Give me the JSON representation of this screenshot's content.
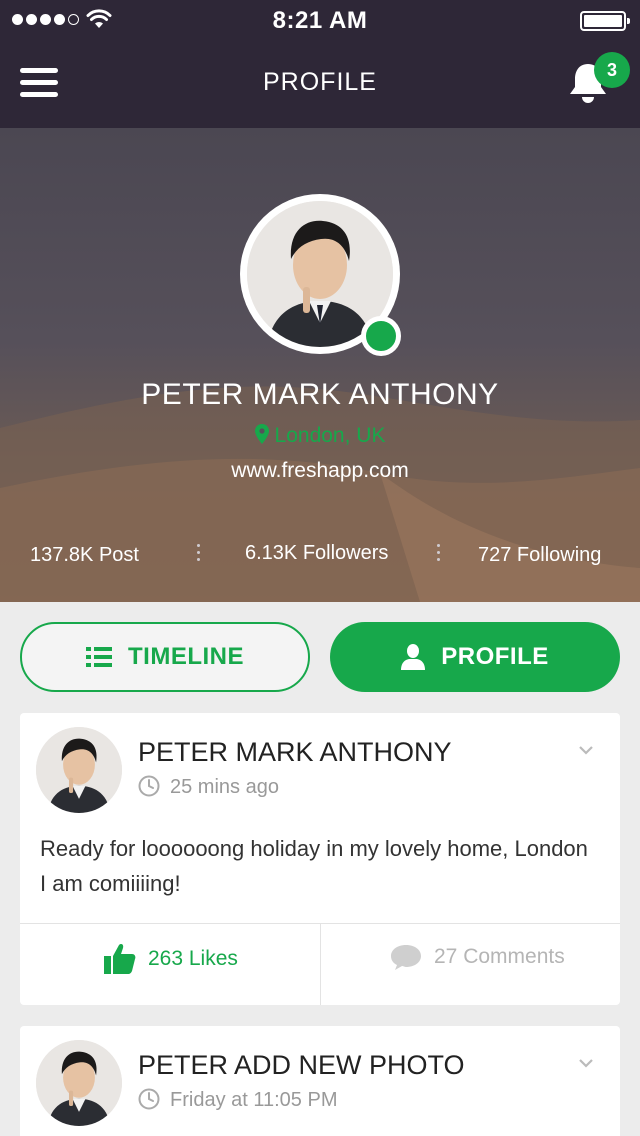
{
  "status": {
    "time": "8:21 AM"
  },
  "nav": {
    "title": "PROFILE",
    "notification_count": "3"
  },
  "profile": {
    "name": "PETER MARK ANTHONY",
    "location": "London, UK",
    "website": "www.freshapp.com",
    "stats": {
      "posts": "137.8K Post",
      "followers": "6.13K Followers",
      "following": "727 Following"
    }
  },
  "tabs": {
    "timeline": "TIMELINE",
    "profile": "PROFILE"
  },
  "posts": [
    {
      "title": "PETER MARK ANTHONY",
      "time": "25 mins ago",
      "text": "Ready for loooooong holiday in my lovely home, London I am comiiiing!",
      "likes": "263 Likes",
      "comments": "27 Comments"
    },
    {
      "title": "PETER ADD NEW PHOTO",
      "time": "Friday at 11:05 PM"
    }
  ],
  "colors": {
    "accent": "#17a84b",
    "header_bg": "#2e2737"
  },
  "icons": [
    "menu-icon",
    "bell-icon",
    "map-pin-icon",
    "list-icon",
    "user-icon",
    "clock-icon",
    "chevron-down-icon",
    "thumbs-up-icon",
    "comment-icon"
  ]
}
